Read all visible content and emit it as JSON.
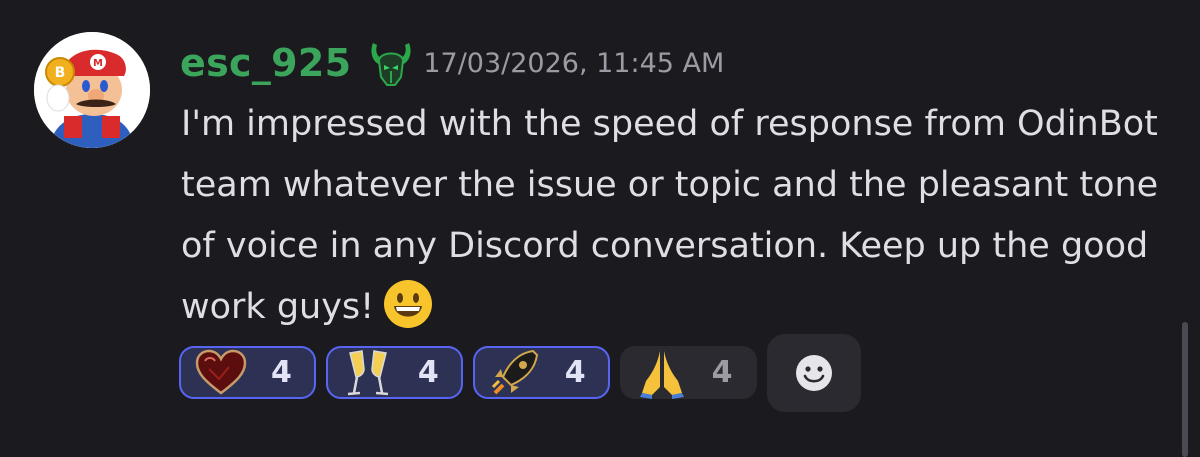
{
  "message": {
    "author": {
      "username": "esc_925",
      "name_color": "#3ba55c"
    },
    "timestamp": "17/03/2026, 11:45 AM",
    "text": "I'm impressed with the speed of response from OdinBot team whatever the issue or topic and the pleasant tone of voice in any Discord conversation. Keep up the good work guys!",
    "trailing_emoji": "grinning-face",
    "reactions": [
      {
        "emoji": "heart-crystal",
        "count": "4",
        "reacted": true
      },
      {
        "emoji": "clinking-glasses",
        "count": "4",
        "reacted": true
      },
      {
        "emoji": "rocket",
        "count": "4",
        "reacted": true
      },
      {
        "emoji": "folded-hands",
        "count": "4",
        "reacted": false
      }
    ],
    "add_reaction_icon": "add-reaction-icon"
  },
  "colors": {
    "background": "#1b1b1f",
    "accent": "#5865f2",
    "text": "#dedee3",
    "muted": "#9b9ba4"
  }
}
